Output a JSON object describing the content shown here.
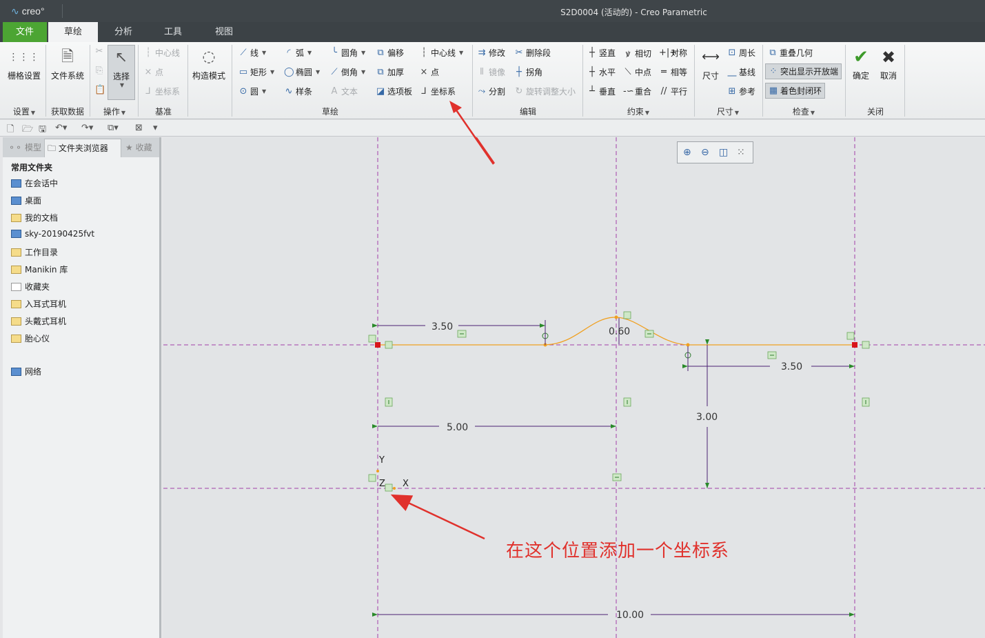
{
  "window": {
    "logo": "creo",
    "title": "S2D0004 (活动的) - Creo Parametric"
  },
  "tabs": [
    {
      "label": "文件"
    },
    {
      "label": "草绘"
    },
    {
      "label": "分析"
    },
    {
      "label": "工具"
    },
    {
      "label": "视图"
    }
  ],
  "ribbon": {
    "setup": {
      "grid_settings": "栅格设置",
      "label": "设置"
    },
    "get_data": {
      "file_system": "文件系统",
      "label": "获取数据"
    },
    "operations": {
      "select": "选择",
      "label": "操作"
    },
    "datum": {
      "centerline": "中心线",
      "point": "点",
      "coord_sys": "坐标系",
      "label": "基准"
    },
    "construction": {
      "label": "构造模式"
    },
    "sketch": {
      "line": "线",
      "arc": "弧",
      "fillet": "圆角",
      "offset": "偏移",
      "centerline": "中心线",
      "rectangle": "矩形",
      "ellipse": "椭圆",
      "chamfer": "倒角",
      "thicken": "加厚",
      "point": "点",
      "circle": "圆",
      "spline": "样条",
      "text": "文本",
      "palette": "选项板",
      "coord_sys": "坐标系",
      "label": "草绘"
    },
    "edit": {
      "modify": "修改",
      "delete_segment": "删除段",
      "mirror": "镜像",
      "corner": "拐角",
      "divide": "分割",
      "rotate_resize": "旋转调整大小",
      "label": "编辑"
    },
    "constrain": {
      "vertical": "竖直",
      "tangent": "相切",
      "symmetric": "对称",
      "horizontal": "水平",
      "midpoint": "中点",
      "equal": "相等",
      "perpendicular": "垂直",
      "coincident": "重合",
      "parallel": "平行",
      "label": "约束"
    },
    "dimension": {
      "dimension": "尺寸",
      "perimeter": "周长",
      "baseline": "基线",
      "reference": "参考",
      "label": "尺寸"
    },
    "inspect": {
      "overlap": "重叠几何",
      "highlight_open": "突出显示开放端",
      "shade_closed": "着色封闭环",
      "label": "检查"
    },
    "close": {
      "ok": "确定",
      "cancel": "取消",
      "label": "关闭"
    }
  },
  "left_panel": {
    "tabs": [
      {
        "label": "模型"
      },
      {
        "label": "文件夹浏览器"
      },
      {
        "label": "收藏"
      }
    ],
    "heading": "常用文件夹",
    "folders": [
      {
        "label": "在会话中"
      },
      {
        "label": "桌面"
      },
      {
        "label": "我的文档"
      },
      {
        "label": "sky-20190425fvt"
      },
      {
        "label": "工作目录"
      },
      {
        "label": "Manikin 库"
      },
      {
        "label": "收藏夹"
      },
      {
        "label": "入耳式耳机"
      },
      {
        "label": "头戴式耳机"
      },
      {
        "label": "胎心仪"
      },
      {
        "label": "网络"
      }
    ]
  },
  "sketch": {
    "dims": {
      "d1": "3.50",
      "d2": "0.60",
      "d3": "3.50",
      "d4": "5.00",
      "d5": "3.00",
      "d6": "10.00"
    },
    "axes": {
      "y": "Y",
      "z": "Z",
      "x": "X"
    },
    "annotation": "在这个位置添加一个坐标系"
  },
  "colors": {
    "file_tab": "#4ca533",
    "sketch_geometry": "#f0a020",
    "annotation": "#e0312c",
    "dimension": "#4b1f73",
    "centerline": "#a23ea8"
  }
}
